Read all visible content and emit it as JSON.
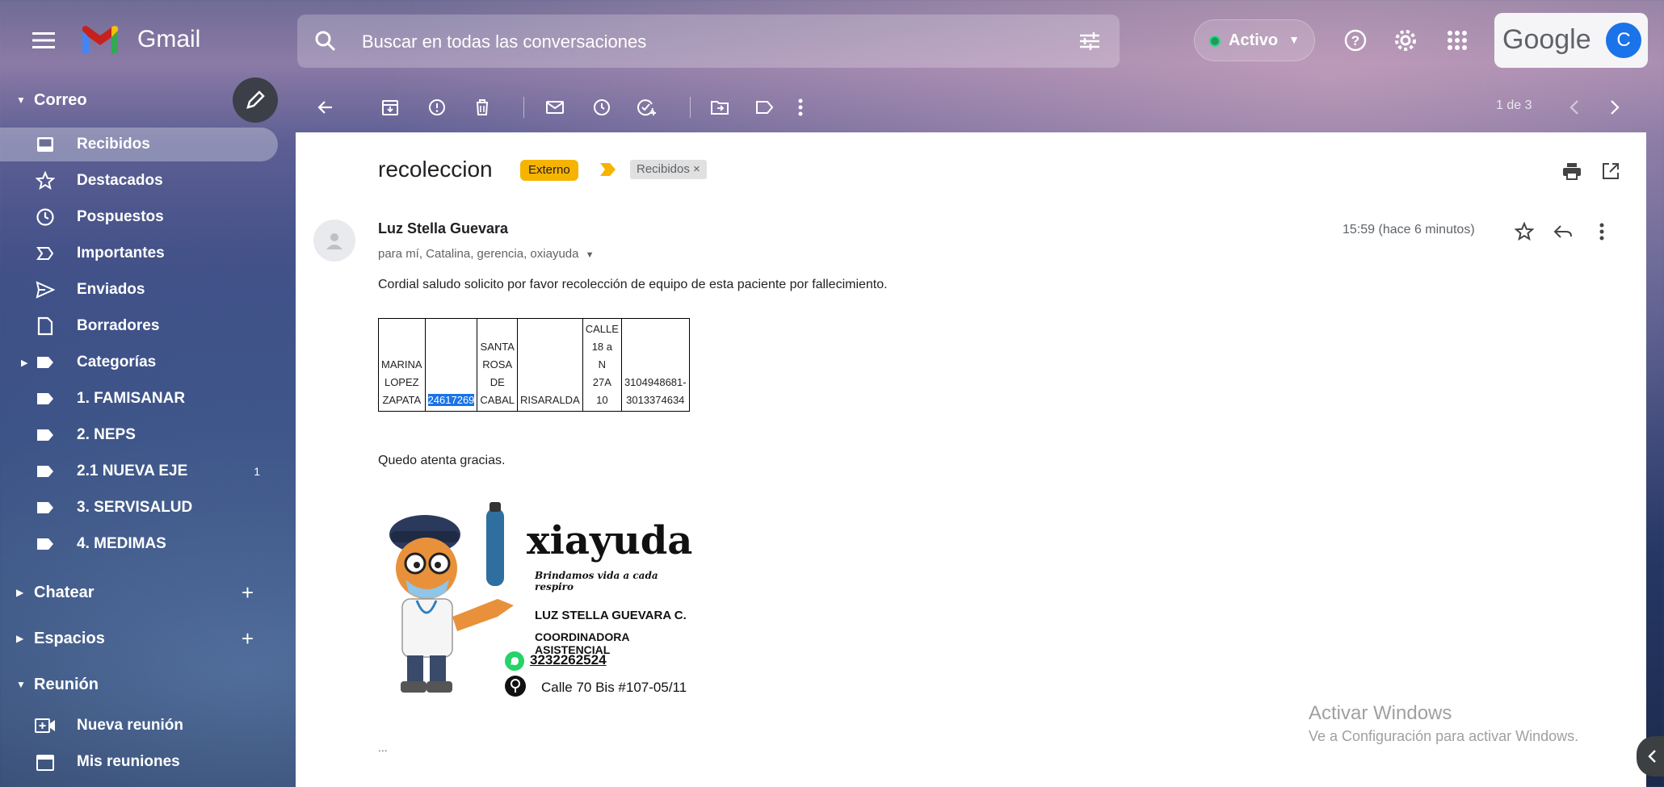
{
  "app": {
    "name": "Gmail",
    "search_placeholder": "Buscar en todas las conversaciones",
    "status": "Activo",
    "brand": "Google",
    "avatar_letter": "C"
  },
  "sidebar": {
    "correo_label": "Correo",
    "items": [
      {
        "label": "Recibidos",
        "icon": "inbox-icon"
      },
      {
        "label": "Destacados",
        "icon": "star-icon"
      },
      {
        "label": "Pospuestos",
        "icon": "clock-icon"
      },
      {
        "label": "Importantes",
        "icon": "important-icon"
      },
      {
        "label": "Enviados",
        "icon": "send-icon"
      },
      {
        "label": "Borradores",
        "icon": "draft-icon"
      },
      {
        "label": "Categorías",
        "icon": "label-icon"
      },
      {
        "label": "1. FAMISANAR",
        "icon": "label-icon"
      },
      {
        "label": "2. NEPS",
        "icon": "label-icon"
      },
      {
        "label": "2.1 NUEVA EJE",
        "icon": "label-icon",
        "count": "1"
      },
      {
        "label": "3. SERVISALUD",
        "icon": "label-icon"
      },
      {
        "label": "4. MEDIMAS",
        "icon": "label-icon"
      }
    ],
    "chat_label": "Chatear",
    "spaces_label": "Espacios",
    "meet_label": "Reunión",
    "meet_items": [
      {
        "label": "Nueva reunión",
        "icon": "video-add-icon"
      },
      {
        "label": "Mis reuniones",
        "icon": "calendar-icon"
      }
    ]
  },
  "toolbar": {
    "pager": "1 de 3"
  },
  "email": {
    "subject": "recoleccion",
    "external_badge": "Externo",
    "inbox_label": "Recibidos",
    "sender": "Luz Stella Guevara",
    "recipients": "para mí, Catalina, gerencia, oxiayuda",
    "time": "15:59 (hace 6 minutos)",
    "body_intro": "Cordial saludo solicito por favor recolección de equipo de esta paciente por fallecimiento.",
    "table": {
      "cells": [
        [
          "MARINA",
          "LOPEZ",
          "ZAPATA"
        ],
        [
          "24617269"
        ],
        [
          "SANTA",
          "ROSA",
          "DE",
          "CABAL"
        ],
        [
          "RISARALDA"
        ],
        [
          "CALLE",
          "18 a",
          "N",
          "27A",
          "10"
        ],
        [
          "3104948681-",
          "3013374634"
        ]
      ]
    },
    "closing": "Quedo atenta gracias.",
    "signature": {
      "brand": "xiayuda",
      "tagline": "Brindamos vida a cada respiro",
      "name": "LUZ STELLA GUEVARA C.",
      "role": "COORDINADORA ASISTENCIAL",
      "phone": "3232262524",
      "address": "Calle 70 Bis #107-05/11"
    },
    "trimmed": "..."
  },
  "watermark": {
    "line1": "Activar Windows",
    "line2": "Ve a Configuración para activar Windows."
  }
}
